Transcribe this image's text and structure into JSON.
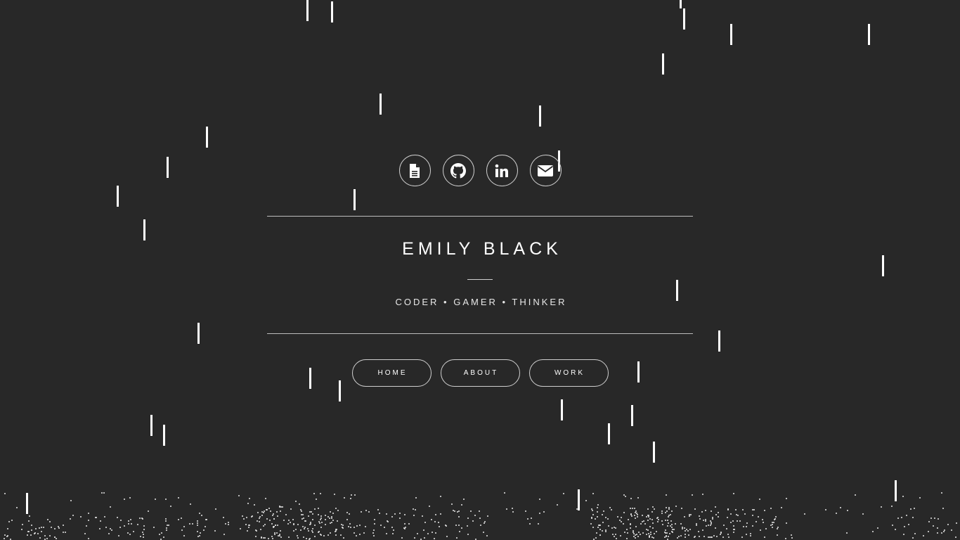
{
  "profile": {
    "name": "EMILY BLACK",
    "tagline": "CODER • GAMER • THINKER"
  },
  "social_links": [
    {
      "icon": "document-icon",
      "label": "Resume"
    },
    {
      "icon": "github-icon",
      "label": "GitHub"
    },
    {
      "icon": "linkedin-icon",
      "label": "LinkedIn"
    },
    {
      "icon": "mail-icon",
      "label": "Email"
    }
  ],
  "nav": {
    "home": "HOME",
    "about": "ABOUT",
    "work": "WORK"
  },
  "colors": {
    "background": "#282828",
    "foreground": "#ffffff",
    "rule": "#bdbdbd"
  }
}
